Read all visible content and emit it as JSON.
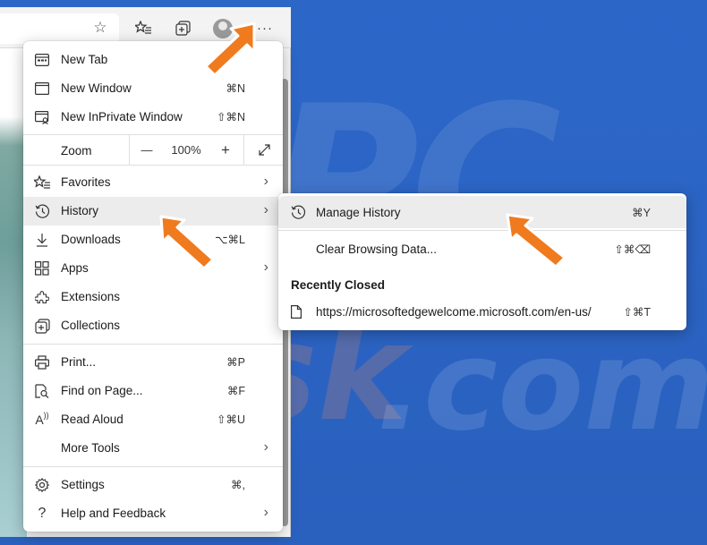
{
  "menu": {
    "items": [
      {
        "label": "New Tab",
        "shortcut": "",
        "icon": "new-tab-icon"
      },
      {
        "label": "New Window",
        "shortcut": "⌘N",
        "icon": "new-window-icon"
      },
      {
        "label": "New InPrivate Window",
        "shortcut": "⇧⌘N",
        "icon": "inprivate-icon"
      }
    ],
    "zoom": {
      "label": "Zoom",
      "minus": "—",
      "value": "100%",
      "plus": "+"
    },
    "group2": [
      {
        "label": "Favorites",
        "shortcut": "",
        "icon": "favorites-icon"
      },
      {
        "label": "History",
        "shortcut": "",
        "icon": "history-icon"
      },
      {
        "label": "Downloads",
        "shortcut": "⌥⌘L",
        "icon": "download-icon"
      },
      {
        "label": "Apps",
        "shortcut": "",
        "icon": "apps-icon"
      },
      {
        "label": "Extensions",
        "shortcut": "",
        "icon": "extensions-icon"
      },
      {
        "label": "Collections",
        "shortcut": "",
        "icon": "collections-icon"
      }
    ],
    "group3": [
      {
        "label": "Print...",
        "shortcut": "⌘P",
        "icon": "print-icon"
      },
      {
        "label": "Find on Page...",
        "shortcut": "⌘F",
        "icon": "find-icon"
      },
      {
        "label": "Read Aloud",
        "shortcut": "⇧⌘U",
        "icon": "read-aloud-icon"
      },
      {
        "label": "More Tools",
        "shortcut": "",
        "icon": ""
      }
    ],
    "group4": [
      {
        "label": "Settings",
        "shortcut": "⌘,",
        "icon": "settings-icon"
      },
      {
        "label": "Help and Feedback",
        "shortcut": "",
        "icon": "help-icon"
      }
    ]
  },
  "submenu": {
    "manage_history": {
      "label": "Manage History",
      "shortcut": "⌘Y"
    },
    "clear_data": {
      "label": "Clear Browsing Data...",
      "shortcut": "⇧⌘⌫"
    },
    "recently_closed_heading": "Recently Closed",
    "recent_items": [
      {
        "label": "https://microsoftedgewelcome.microsoft.com/en-us/",
        "shortcut": "⇧⌘T"
      }
    ]
  },
  "toolbar": {
    "more_button": "···"
  },
  "colors": {
    "accent_arrow": "#f07a1e",
    "background": "#2a63c4"
  }
}
